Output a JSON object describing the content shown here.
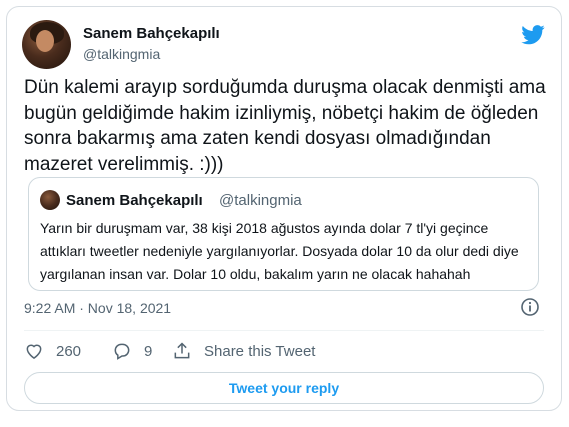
{
  "author": {
    "name": "Sanem Bahçekapılı",
    "handle": "@talkingmia"
  },
  "tweet": {
    "text": "Dün kalemi arayıp sorduğumda duruşma olacak denmişti ama bugün geldiğimde hakim izinliymiş, nöbetçi hakim de öğleden sonra bakarmış ama zaten kendi dosyası olmadığından mazeret verelimmiş. :)))",
    "timestamp": "9:22 AM · Nov 18, 2021"
  },
  "quoted_tweet": {
    "name": "Sanem Bahçekapılı",
    "handle": "@talkingmia",
    "text": "Yarın bir duruşmam var, 38 kişi 2018 ağustos ayında dolar 7 tl'yi geçince attıkları tweetler nedeniyle yargılanıyorlar. Dosyada dolar 10 da olur dedi diye yargılanan insan var. Dolar 10 oldu, bakalım yarın ne olacak hahahah"
  },
  "actions": {
    "like_count": "260",
    "reply_count": "9",
    "share_label": "Share this Tweet"
  },
  "reply_button_label": "Tweet your reply",
  "colors": {
    "accent": "#1d9bf0",
    "text": "#0f1419",
    "secondary": "#536471",
    "border": "#cfd9de"
  },
  "icons": [
    "twitter-bird-icon",
    "info-icon",
    "heart-icon",
    "reply-icon",
    "share-icon"
  ]
}
